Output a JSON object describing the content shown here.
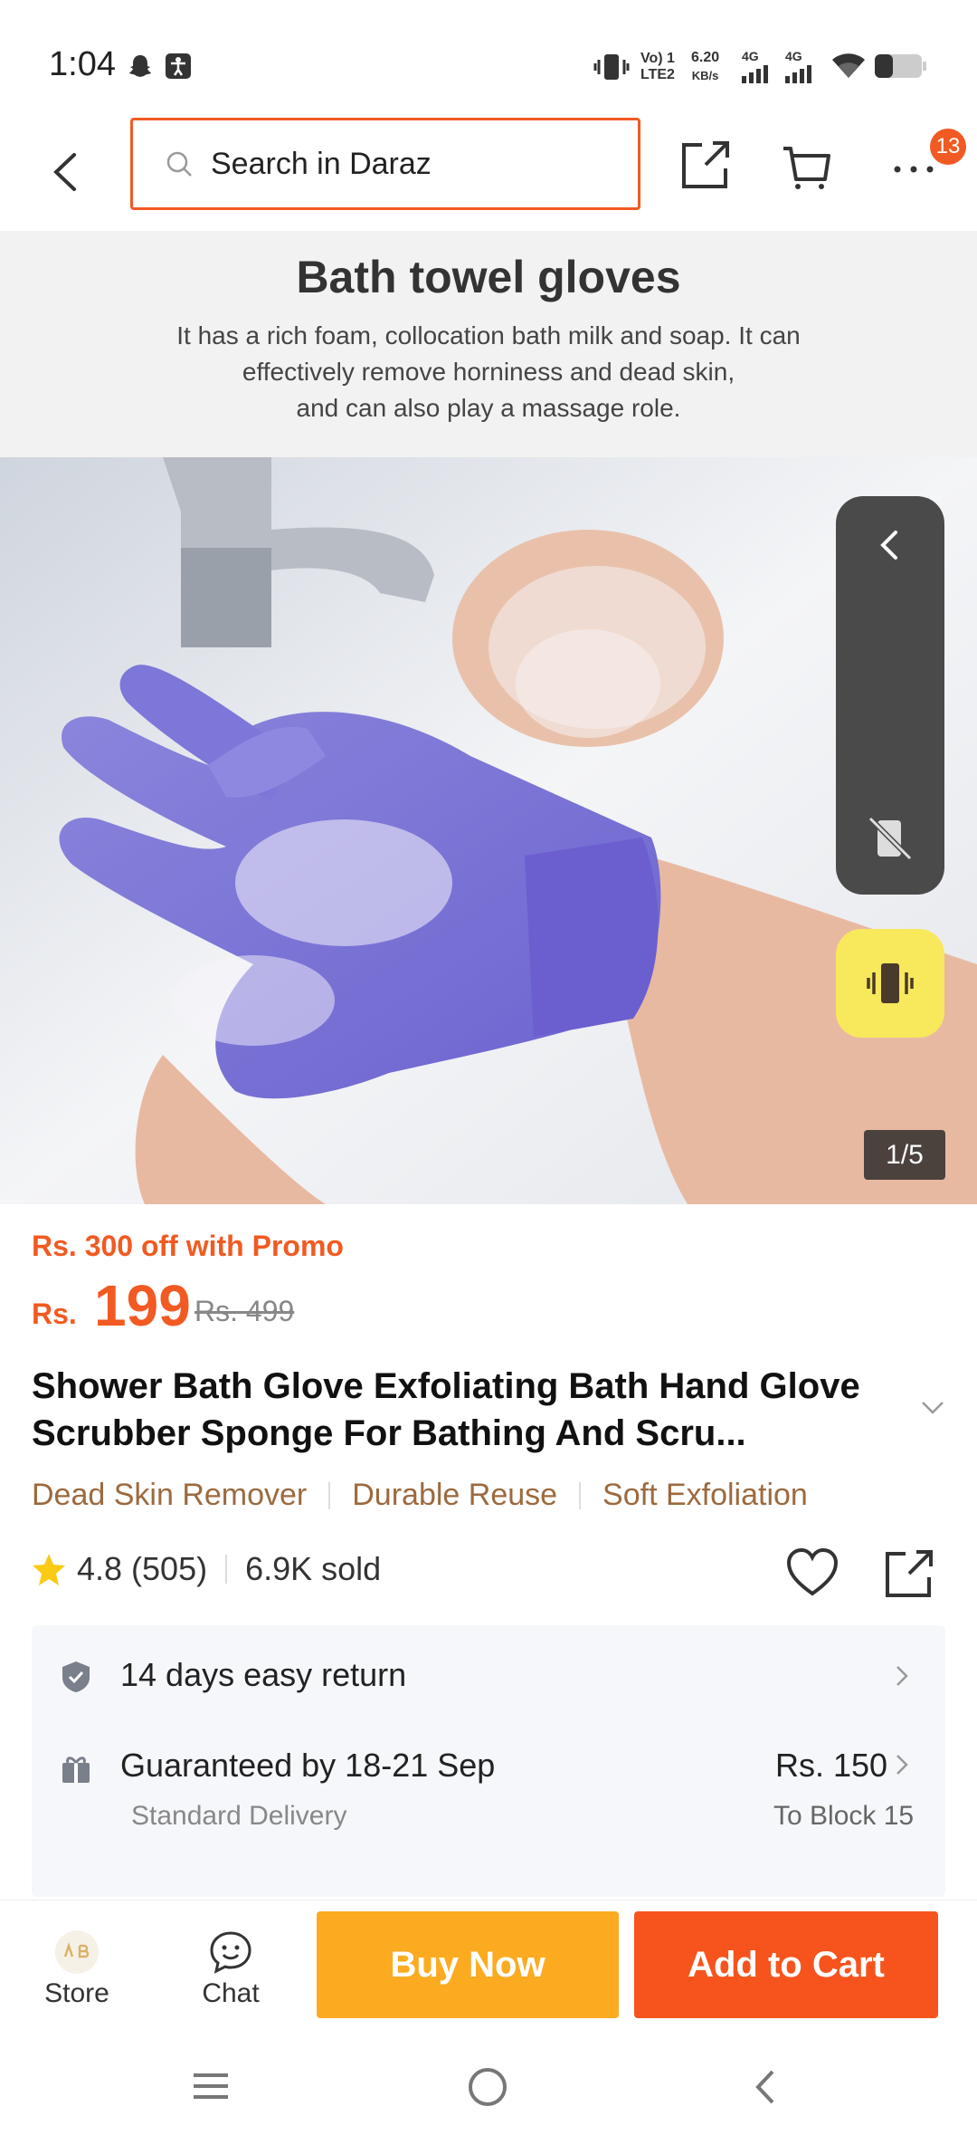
{
  "status_bar": {
    "time": "1:04",
    "net_label_1": "Vo) 1",
    "net_label_2": "LTE2",
    "speed": "6.20",
    "speed_unit": "KB/s",
    "sig1": "4G",
    "sig2": "4G"
  },
  "header": {
    "search_placeholder": "Search in Daraz",
    "cart_badge": "13"
  },
  "banner": {
    "title": "Bath towel gloves",
    "description_lines": [
      "It has a rich foam, collocation bath milk and soap. It can",
      "effectively remove horniness and dead skin,",
      "and can also play a massage role."
    ]
  },
  "gallery": {
    "counter": "1/5"
  },
  "product": {
    "promo": "Rs. 300 off with Promo",
    "currency": "Rs.",
    "price": "199",
    "old_price": "Rs. 499",
    "title": "Shower Bath Glove Exfoliating Bath Hand Glove Scrubber Sponge For Bathing And Scru...",
    "tags": [
      "Dead Skin Remover",
      "Durable Reuse",
      "Soft Exfoliation"
    ],
    "rating": "4.8 (505)",
    "sold": "6.9K sold"
  },
  "services": {
    "return_text": "14 days easy return",
    "delivery_text": "Guaranteed by 18-21 Sep",
    "delivery_sub": "Standard Delivery",
    "delivery_price": "Rs. 150",
    "delivery_location": "To Block 15"
  },
  "bottom_bar": {
    "store_label": "Store",
    "chat_label": "Chat",
    "buy_now": "Buy Now",
    "add_to_cart": "Add to Cart"
  },
  "colors": {
    "accent": "#f15a22",
    "buy_now": "#fcab20",
    "add_to_cart": "#f7541d",
    "tag": "#9c6a3f"
  }
}
